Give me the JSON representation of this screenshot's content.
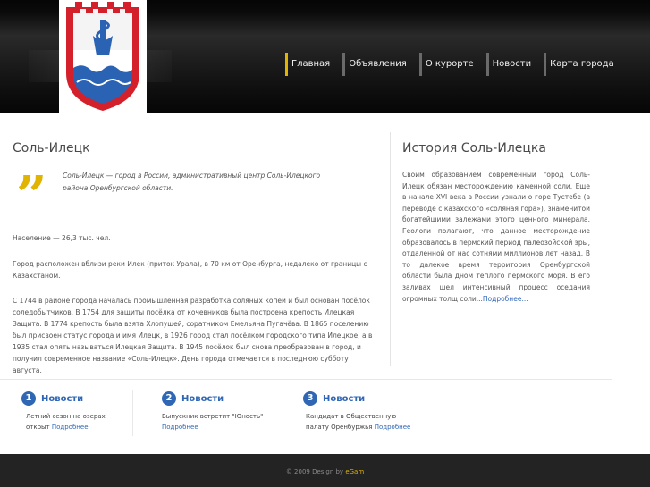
{
  "header": {
    "nav": [
      {
        "label": "Главная",
        "active": true
      },
      {
        "label": "Объявления",
        "active": false
      },
      {
        "label": "О курорте",
        "active": false
      },
      {
        "label": "Новости",
        "active": false
      },
      {
        "label": "Карта города",
        "active": false
      }
    ],
    "accent_color": "#e0b400"
  },
  "left": {
    "title": "Соль-Илецк",
    "quote": "Соль-Илецк — город в России, административный центр Соль-Илецкого района Оренбургской области.",
    "population": "Население — 26,3 тыс. чел.",
    "para2": "Город расположен вблизи реки Илек (приток Урала), в 70 км от Оренбурга, недалеко от границы с Казахстаном.",
    "para3": "С 1744 в районе города началась промышленная разработка соляных копей и был основан посёлок соледобытчиков. В 1754 для защиты посёлка от кочевников была построена крепость Илецкая Защита. В 1774 крепость была взята Хлопушей, соратником Емельяна Пугачёва. В 1865 поселению был присвоен статус города и имя Илецк, в 1926 город стал посёлком городского типа Илецкое, а в 1935 стал опять называться Илецкая Защита. В 1945 посёлок был снова преобразован в город, и получил современное название «Соль-Илецк». День города отмечается в последнюю субботу августа."
  },
  "right": {
    "title": "История Соль-Илецка",
    "text": "Своим образованием современный город Соль-Илецк обязан месторождению каменной соли. Еще в начале XVI века в России узнали о горе Тустебе (в переводе с казахского «соляная гора»), знаменитой богатейшими залежами этого ценного минерала. Геологи полагают, что данное месторождение образовалось в пермский период палеозойской эры, отдаленной от нас сотнями миллионов лет назад. В то далекое время территория Оренбургской области была дном теплого пермского моря. В его заливах шел интенсивный процесс оседания огромных толщ соли...",
    "more": "Подробнее..."
  },
  "news": [
    {
      "num": "1",
      "title": "Новости",
      "text": "Летний сезон на озерах открыт",
      "more": "Подробнее"
    },
    {
      "num": "2",
      "title": "Новости",
      "text": "Выпускник встретит \"Юность\"",
      "more": "Подробнее"
    },
    {
      "num": "3",
      "title": "Новости",
      "text": "Кандидат в Общественную палату Оренбуржья",
      "more": "Подробнее"
    }
  ],
  "footer": {
    "copyright": "© 2009 Design by",
    "brand": "eGam"
  }
}
